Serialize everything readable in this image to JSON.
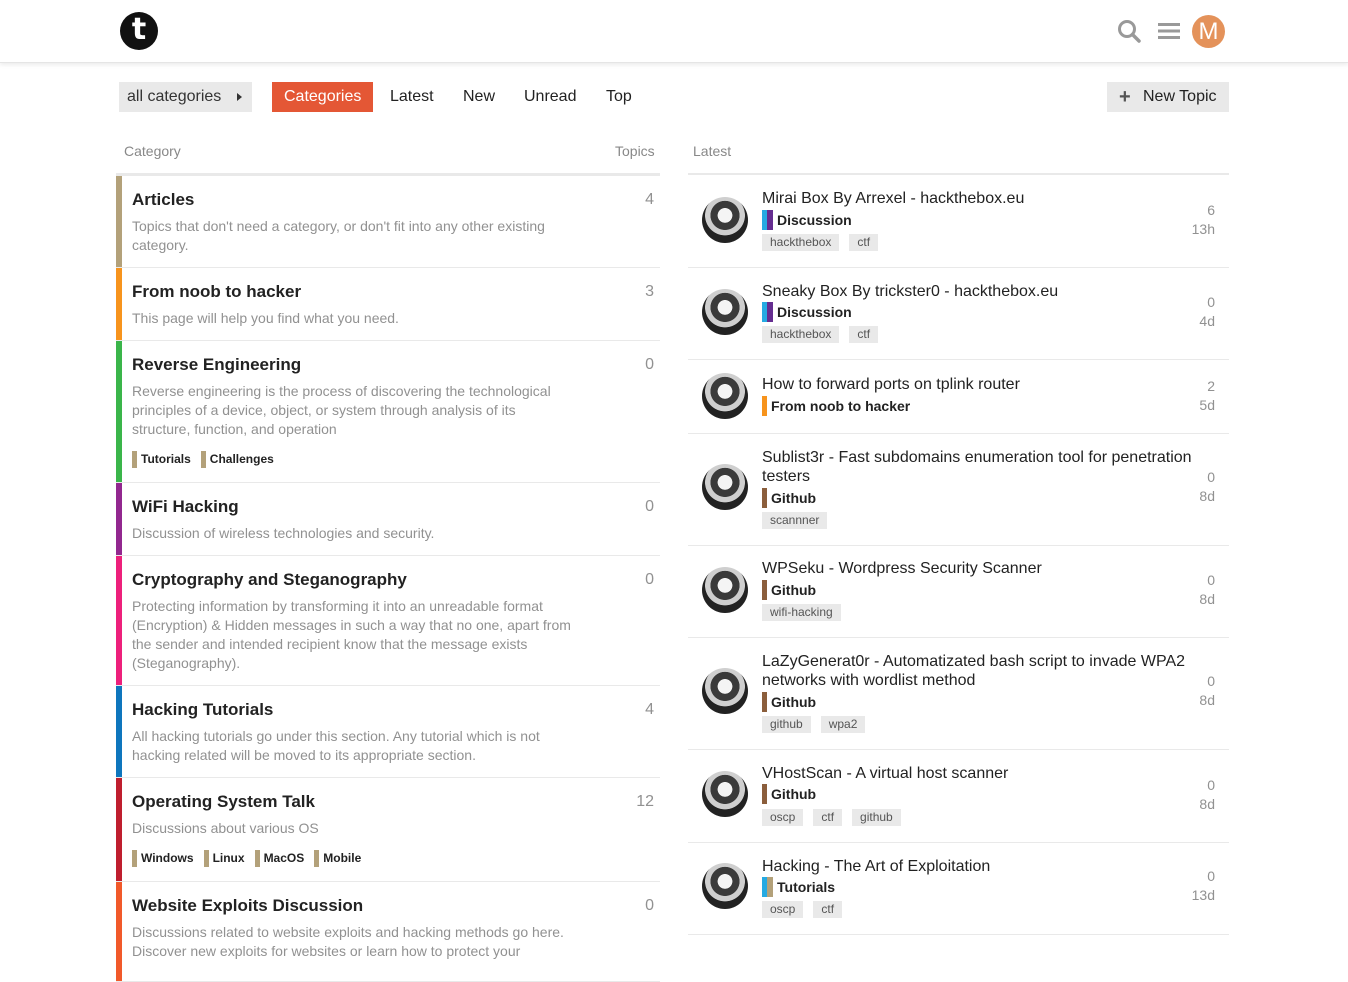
{
  "header": {
    "logo": "t",
    "search_icon": "search-icon",
    "menu_icon": "hamburger-icon",
    "avatar_letter": "M",
    "avatar_color": "#e4925a"
  },
  "nav": {
    "category_dropdown": "all categories",
    "tabs": [
      "Categories",
      "Latest",
      "New",
      "Unread",
      "Top"
    ],
    "active_tab": "Categories",
    "new_topic": "New Topic",
    "accent_color": "#e45735"
  },
  "columns": {
    "category": "Category",
    "topics": "Topics",
    "latest": "Latest"
  },
  "categories": [
    {
      "name": "Articles",
      "desc": "Topics that don't need a category, or don't fit into any other existing category.",
      "count": "4",
      "color": "#b3a17a"
    },
    {
      "name": "From noob to hacker",
      "desc": "This page will help you find what you need.",
      "count": "3",
      "color": "#f7941d"
    },
    {
      "name": "Reverse Engineering",
      "desc": "Reverse engineering is the process of discovering the technological principles of a device, object, or system through analysis of its structure, function, and operation",
      "count": "0",
      "color": "#3ab54a",
      "subcategories": [
        "Tutorials",
        "Challenges"
      ]
    },
    {
      "name": "WiFi Hacking",
      "desc": "Discussion of wireless technologies and security.",
      "count": "0",
      "color": "#92278f"
    },
    {
      "name": "Cryptography and Steganography",
      "desc": "Protecting information by transforming it into an unreadable format (Encryption) & Hidden messages in such a way that no one, apart from the sender and intended recipient know that the message exists (Steganography).",
      "count": "0",
      "color": "#ed207b"
    },
    {
      "name": "Hacking Tutorials",
      "desc": "All hacking tutorials go under this section. Any tutorial which is not hacking related will be moved to its appropriate section.",
      "count": "4",
      "color": "#0e76bd"
    },
    {
      "name": "Operating System Talk",
      "desc": "Discussions about various OS",
      "count": "12",
      "color": "#bf1e2e",
      "subcategories": [
        "Windows",
        "Linux",
        "MacOS",
        "Mobile"
      ]
    },
    {
      "name": "Website Exploits Discussion",
      "desc": "Discussions related to website exploits and hacking methods go here. Discover new exploits for websites or learn how to protect your",
      "count": "0",
      "color": "#f1592a"
    }
  ],
  "topics": [
    {
      "title": "Mirai Box By Arrexel - hackthebox.eu",
      "category": "Discussion",
      "cat_color": "#25aae2",
      "cat_color2": "#652d90",
      "tags": [
        "hackthebox",
        "ctf"
      ],
      "replies": "6",
      "age": "13h"
    },
    {
      "title": "Sneaky Box By trickster0 - hackthebox.eu",
      "category": "Discussion",
      "cat_color": "#25aae2",
      "cat_color2": "#652d90",
      "tags": [
        "hackthebox",
        "ctf"
      ],
      "replies": "0",
      "age": "4d"
    },
    {
      "title": "How to forward ports on tplink router",
      "category": "From noob to hacker",
      "cat_color": "#f7941d",
      "tags": [],
      "replies": "2",
      "age": "5d"
    },
    {
      "title": "Sublist3r - Fast subdomains enumeration tool for penetration testers",
      "category": "Github",
      "cat_color": "#8b5e3c",
      "tags": [
        "scannner"
      ],
      "replies": "0",
      "age": "8d"
    },
    {
      "title": "WPSeku - Wordpress Security Scanner",
      "category": "Github",
      "cat_color": "#8b5e3c",
      "tags": [
        "wifi-hacking"
      ],
      "replies": "0",
      "age": "8d"
    },
    {
      "title": "LaZyGenerat0r - Automatizated bash script to invade WPA2 networks with wordlist method",
      "category": "Github",
      "cat_color": "#8b5e3c",
      "tags": [
        "github",
        "wpa2"
      ],
      "replies": "0",
      "age": "8d"
    },
    {
      "title": "VHostScan - A virtual host scanner",
      "category": "Github",
      "cat_color": "#8b5e3c",
      "tags": [
        "oscp",
        "ctf",
        "github"
      ],
      "replies": "0",
      "age": "8d"
    },
    {
      "title": "Hacking - The Art of Exploitation",
      "category": "Tutorials",
      "cat_color": "#25aae2",
      "cat_color2": "#b3a17a",
      "tags": [
        "oscp",
        "ctf"
      ],
      "replies": "0",
      "age": "13d"
    }
  ]
}
